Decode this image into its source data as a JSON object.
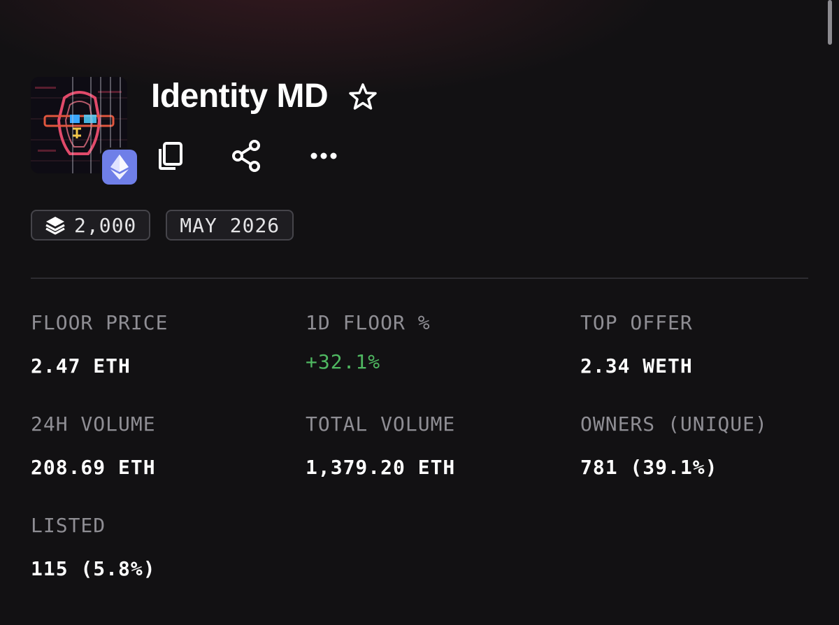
{
  "collection": {
    "name": "Identity MD",
    "chain_icon": "ethereum-icon",
    "favorite_icon": "star-outline-icon"
  },
  "actions": [
    {
      "icon": "copy-icon"
    },
    {
      "icon": "share-icon"
    },
    {
      "icon": "more-horizontal-icon"
    }
  ],
  "chips": {
    "supply": {
      "icon": "layers-icon",
      "value": "2,000"
    },
    "date": {
      "value": "MAY 2026"
    }
  },
  "stats": {
    "floor_price": {
      "label": "FLOOR PRICE",
      "value": "2.47 ETH"
    },
    "floor_change_1d": {
      "label": "1D FLOOR %",
      "value": "+32.1%",
      "color": "#4fb861"
    },
    "top_offer": {
      "label": "TOP OFFER",
      "value": "2.34 WETH"
    },
    "volume_24h": {
      "label": "24H VOLUME",
      "value": "208.69 ETH"
    },
    "total_volume": {
      "label": "TOTAL VOLUME",
      "value": "1,379.20 ETH"
    },
    "owners": {
      "label": "OWNERS (UNIQUE)",
      "value": "781 (39.1%)"
    },
    "listed": {
      "label": "LISTED",
      "value": "115 (5.8%)"
    }
  },
  "colors": {
    "background": "#121113",
    "chain_badge": "#6f7fe8",
    "positive": "#4fb861",
    "label": "#8f8e94"
  }
}
